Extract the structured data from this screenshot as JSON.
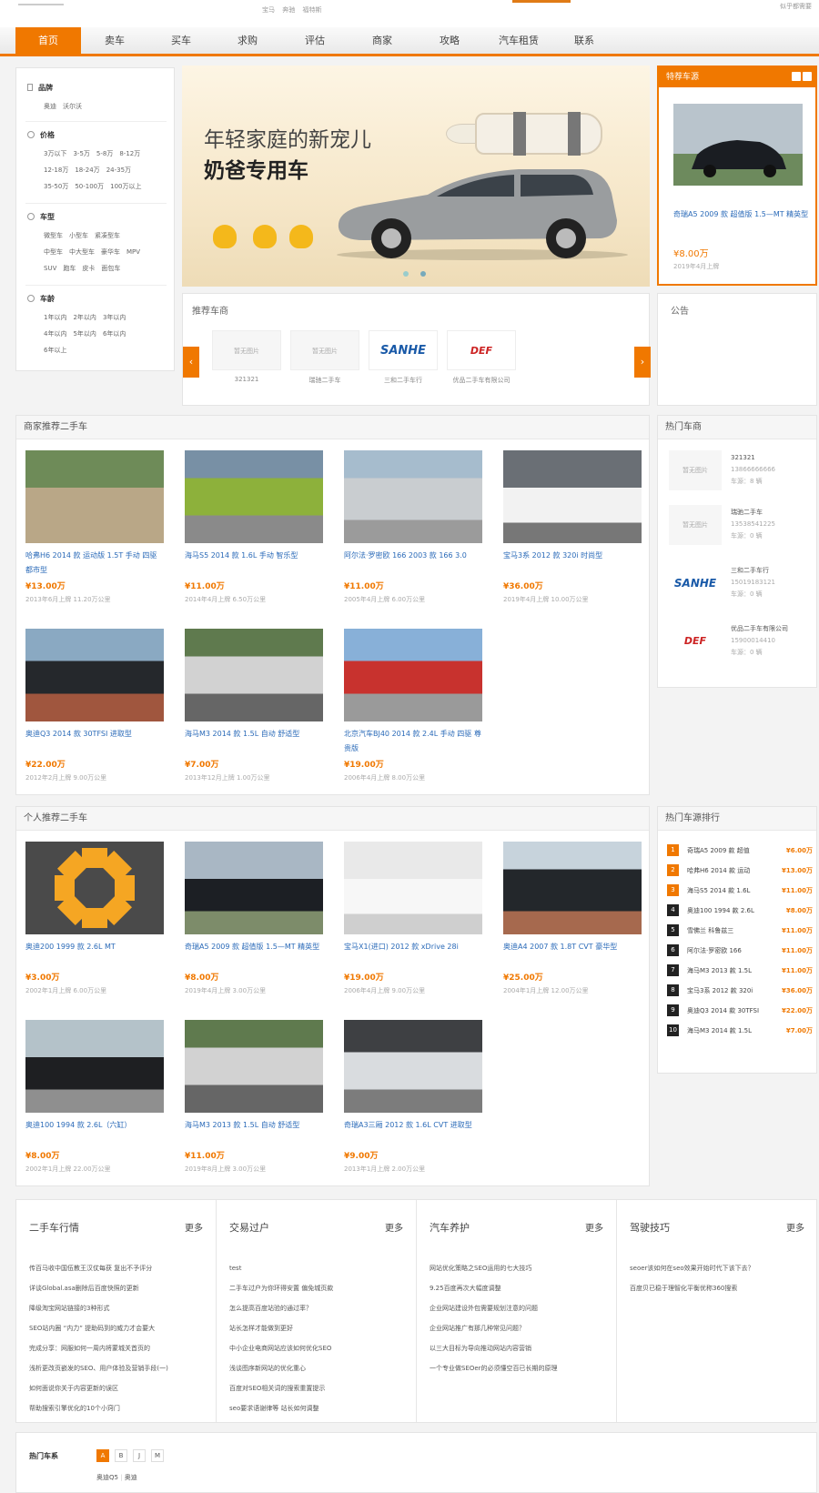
{
  "topbar": {
    "search_links": [
      "宝马",
      "奔驰",
      "福特斯"
    ],
    "right_text": "似乎都需要"
  },
  "nav": [
    "首页",
    "卖车",
    "买车",
    "求购",
    "评估",
    "商家",
    "攻略",
    "汽车租赁",
    "联系"
  ],
  "filter": {
    "groups": [
      {
        "title": "品牌",
        "icon": "bookmark-icon",
        "options": [
          "奥迪",
          "沃尔沃"
        ]
      },
      {
        "title": "价格",
        "icon": "price-icon",
        "options": [
          "3万以下",
          "3-5万",
          "5-8万",
          "8-12万",
          "12-18万",
          "18-24万",
          "24-35万",
          "35-50万",
          "50-100万",
          "100万以上"
        ]
      },
      {
        "title": "车型",
        "icon": "car-icon",
        "options": [
          "微型车",
          "小型车",
          "紧凑型车",
          "中型车",
          "中大型车",
          "豪华车",
          "MPV",
          "SUV",
          "跑车",
          "皮卡",
          "面包车"
        ]
      },
      {
        "title": "车龄",
        "icon": "clock-icon",
        "options": [
          "1年以内",
          "2年以内",
          "3年以内",
          "4年以内",
          "5年以内",
          "6年以内",
          "6年以上"
        ]
      }
    ]
  },
  "banner": {
    "line1": "年轻家庭的新宠儿",
    "line2": "奶爸专用车"
  },
  "special": {
    "title": "特荐车源",
    "car_name": "奇瑞A5 2009 款 超值版 1.5—MT 精英型",
    "price": "¥8.00万",
    "meta": "2019年4月上牌"
  },
  "dealers": {
    "title": "推荐车商",
    "items": [
      {
        "pic": "暂无图片",
        "name": "321321"
      },
      {
        "pic": "暂无图片",
        "name": "瑞驰二手车"
      },
      {
        "pic": "SANHE",
        "name": "三和二手车行"
      },
      {
        "pic": "DEF",
        "name": "优品二手车有限公司"
      }
    ]
  },
  "notice": {
    "title": "公告"
  },
  "merchant_section": {
    "title": "商家推荐二手车",
    "items": [
      {
        "title": "哈弗H6 2014 款 运动版 1.5T 手动 四驱 都市型",
        "price": "¥13.00万",
        "meta": "2013年6月上牌  11.20万公里"
      },
      {
        "title": "海马S5 2014 款 1.6L 手动 智乐型",
        "price": "¥11.00万",
        "meta": "2014年4月上牌  6.50万公里"
      },
      {
        "title": "阿尔法·罗密欧 166 2003 款 166 3.0",
        "price": "¥11.00万",
        "meta": "2005年4月上牌  6.00万公里"
      },
      {
        "title": "宝马3系 2012 款 320i 时尚型",
        "price": "¥36.00万",
        "meta": "2019年4月上牌  10.00万公里"
      },
      {
        "title": "奥迪Q3 2014 款 30TFSI 进取型",
        "price": "¥22.00万",
        "meta": "2012年2月上牌  9.00万公里"
      },
      {
        "title": "海马M3 2014 款 1.5L 自动 舒适型",
        "price": "¥7.00万",
        "meta": "2013年12月上牌  1.00万公里"
      },
      {
        "title": "北京汽车BJ40 2014 款 2.4L 手动 四驱 尊贵版",
        "price": "¥19.00万",
        "meta": "2006年4月上牌  8.00万公里"
      }
    ]
  },
  "personal_section": {
    "title": "个人推荐二手车",
    "items": [
      {
        "title": "奥迪200 1999 款 2.6L MT",
        "price": "¥3.00万",
        "meta": "2002年1月上牌  6.00万公里"
      },
      {
        "title": "奇瑞A5 2009 款 超值版 1.5—MT 精英型",
        "price": "¥8.00万",
        "meta": "2019年4月上牌  3.00万公里"
      },
      {
        "title": "宝马X1(进口) 2012 款 xDrive 28i",
        "price": "¥19.00万",
        "meta": "2006年4月上牌  9.00万公里"
      },
      {
        "title": "奥迪A4 2007 款 1.8T CVT 豪华型",
        "price": "¥25.00万",
        "meta": "2004年1月上牌  12.00万公里"
      },
      {
        "title": "奥迪100 1994 款 2.6L（六缸）",
        "price": "¥8.00万",
        "meta": "2002年1月上牌  22.00万公里"
      },
      {
        "title": "海马M3 2013 款 1.5L 自动 舒适型",
        "price": "¥11.00万",
        "meta": "2019年8月上牌  3.00万公里"
      },
      {
        "title": "奇瑞A3三厢 2012 款 1.6L CVT 进取型",
        "price": "¥9.00万",
        "meta": "2013年1月上牌  2.00万公里"
      }
    ]
  },
  "hot_dealers": {
    "title": "热门车商",
    "items": [
      {
        "pic": "暂无图片",
        "name": "321321",
        "phone": "13866666666",
        "count": "车源：8 辆"
      },
      {
        "pic": "暂无图片",
        "name": "瑞驰二手车",
        "phone": "13538541225",
        "count": "车源：0 辆"
      },
      {
        "pic": "SANHE",
        "name": "三和二手车行",
        "phone": "15019183121",
        "count": "车源：0 辆"
      },
      {
        "pic": "DEF",
        "name": "优品二手车有限公司",
        "phone": "15900014410",
        "count": "车源：0 辆"
      }
    ]
  },
  "ranking": {
    "title": "热门车源排行",
    "items": [
      {
        "n": "1",
        "name": "奇瑞A5 2009 款 超值",
        "price": "¥6.00万"
      },
      {
        "n": "2",
        "name": "哈弗H6 2014 款 运动",
        "price": "¥13.00万"
      },
      {
        "n": "3",
        "name": "海马S5 2014 款 1.6L",
        "price": "¥11.00万"
      },
      {
        "n": "4",
        "name": "奥迪100 1994 款 2.6L",
        "price": "¥8.00万"
      },
      {
        "n": "5",
        "name": "雪佛兰 科鲁兹三",
        "price": "¥11.00万"
      },
      {
        "n": "6",
        "name": "阿尔法·罗密欧 166",
        "price": "¥11.00万"
      },
      {
        "n": "7",
        "name": "海马M3 2013 款 1.5L",
        "price": "¥11.00万"
      },
      {
        "n": "8",
        "name": "宝马3系 2012 款 320i",
        "price": "¥36.00万"
      },
      {
        "n": "9",
        "name": "奥迪Q3 2014 款 30TFSI",
        "price": "¥22.00万"
      },
      {
        "n": "10",
        "name": "海马M3 2014 款 1.5L",
        "price": "¥7.00万"
      }
    ]
  },
  "news": [
    {
      "title": "二手车行情",
      "more": "更多",
      "items": [
        "传百马收中国伍教王汉仗每获 复出不予评分",
        "详谈Global.asa删除后百度快照的更新",
        "降级淘宝网站链接的3种形式",
        "SEO站内圈 “内力” 提助码到的威力才会要大",
        "完成分享：网服如何一周内将蒙城关首页的",
        "浅析更改页嵌发的SEO、用户体验及营销手段(一)",
        "如何面说你关于内容更新的误区",
        "帮助搜索引擎优化的10个小窍门"
      ]
    },
    {
      "title": "交易过户",
      "more": "更多",
      "items": [
        "test",
        "二手车过户为你环得安置 偏免城页款",
        "怎么提高百度站验的通过率？",
        "站长怎样才能做到更好",
        "中小企业电商网站应该如何优化SEO",
        "浅谈图序新网站的优化重心",
        "百度对SEO相关词的搜索重置提示",
        "seo要求语谢律等 站长如何调整"
      ]
    },
    {
      "title": "汽车养护",
      "more": "更多",
      "items": [
        "网站优化策略之SEO运用的七大技巧",
        "9.25百度再次大幅度调整",
        "企业网站建设外包需要规划注意的问题",
        "企业网站推广有那几种常见问题？",
        "以三大目标为导向推动网站内容营销",
        "一个专业做SEOer的必须懂空百已长期的原理"
      ]
    },
    {
      "title": "驾驶技巧",
      "more": "更多",
      "items": [
        "seoer该如何在seo效果开始时代下该下去？",
        "百度贝已稳于理智化平衡优称360搜索"
      ]
    }
  ],
  "brands": {
    "title": "热门车系",
    "letters": [
      "A",
      "B",
      "J",
      "M"
    ],
    "links": [
      "奥迪Q5",
      "奥迪"
    ]
  },
  "colors": {
    "accent": "#f07800",
    "link": "#2a6ab8"
  }
}
